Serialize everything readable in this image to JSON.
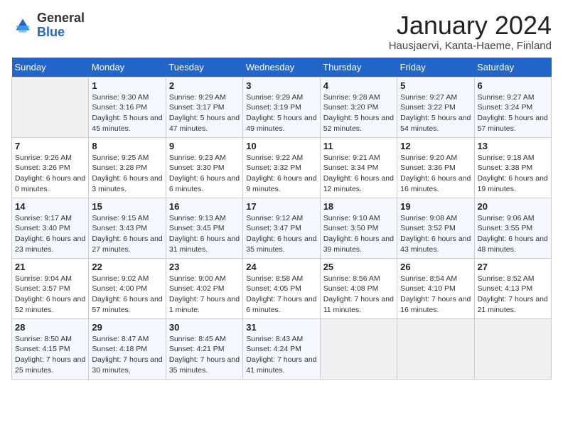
{
  "header": {
    "logo_general": "General",
    "logo_blue": "Blue",
    "month_title": "January 2024",
    "location": "Hausjaervi, Kanta-Haeme, Finland"
  },
  "weekdays": [
    "Sunday",
    "Monday",
    "Tuesday",
    "Wednesday",
    "Thursday",
    "Friday",
    "Saturday"
  ],
  "weeks": [
    [
      {
        "day": "",
        "empty": true
      },
      {
        "day": "1",
        "sunrise": "9:30 AM",
        "sunset": "3:16 PM",
        "daylight": "5 hours and 45 minutes."
      },
      {
        "day": "2",
        "sunrise": "9:29 AM",
        "sunset": "3:17 PM",
        "daylight": "5 hours and 47 minutes."
      },
      {
        "day": "3",
        "sunrise": "9:29 AM",
        "sunset": "3:19 PM",
        "daylight": "5 hours and 49 minutes."
      },
      {
        "day": "4",
        "sunrise": "9:28 AM",
        "sunset": "3:20 PM",
        "daylight": "5 hours and 52 minutes."
      },
      {
        "day": "5",
        "sunrise": "9:27 AM",
        "sunset": "3:22 PM",
        "daylight": "5 hours and 54 minutes."
      },
      {
        "day": "6",
        "sunrise": "9:27 AM",
        "sunset": "3:24 PM",
        "daylight": "5 hours and 57 minutes."
      }
    ],
    [
      {
        "day": "7",
        "sunrise": "9:26 AM",
        "sunset": "3:26 PM",
        "daylight": "6 hours and 0 minutes."
      },
      {
        "day": "8",
        "sunrise": "9:25 AM",
        "sunset": "3:28 PM",
        "daylight": "6 hours and 3 minutes."
      },
      {
        "day": "9",
        "sunrise": "9:23 AM",
        "sunset": "3:30 PM",
        "daylight": "6 hours and 6 minutes."
      },
      {
        "day": "10",
        "sunrise": "9:22 AM",
        "sunset": "3:32 PM",
        "daylight": "6 hours and 9 minutes."
      },
      {
        "day": "11",
        "sunrise": "9:21 AM",
        "sunset": "3:34 PM",
        "daylight": "6 hours and 12 minutes."
      },
      {
        "day": "12",
        "sunrise": "9:20 AM",
        "sunset": "3:36 PM",
        "daylight": "6 hours and 16 minutes."
      },
      {
        "day": "13",
        "sunrise": "9:18 AM",
        "sunset": "3:38 PM",
        "daylight": "6 hours and 19 minutes."
      }
    ],
    [
      {
        "day": "14",
        "sunrise": "9:17 AM",
        "sunset": "3:40 PM",
        "daylight": "6 hours and 23 minutes."
      },
      {
        "day": "15",
        "sunrise": "9:15 AM",
        "sunset": "3:43 PM",
        "daylight": "6 hours and 27 minutes."
      },
      {
        "day": "16",
        "sunrise": "9:13 AM",
        "sunset": "3:45 PM",
        "daylight": "6 hours and 31 minutes."
      },
      {
        "day": "17",
        "sunrise": "9:12 AM",
        "sunset": "3:47 PM",
        "daylight": "6 hours and 35 minutes."
      },
      {
        "day": "18",
        "sunrise": "9:10 AM",
        "sunset": "3:50 PM",
        "daylight": "6 hours and 39 minutes."
      },
      {
        "day": "19",
        "sunrise": "9:08 AM",
        "sunset": "3:52 PM",
        "daylight": "6 hours and 43 minutes."
      },
      {
        "day": "20",
        "sunrise": "9:06 AM",
        "sunset": "3:55 PM",
        "daylight": "6 hours and 48 minutes."
      }
    ],
    [
      {
        "day": "21",
        "sunrise": "9:04 AM",
        "sunset": "3:57 PM",
        "daylight": "6 hours and 52 minutes."
      },
      {
        "day": "22",
        "sunrise": "9:02 AM",
        "sunset": "4:00 PM",
        "daylight": "6 hours and 57 minutes."
      },
      {
        "day": "23",
        "sunrise": "9:00 AM",
        "sunset": "4:02 PM",
        "daylight": "7 hours and 1 minute."
      },
      {
        "day": "24",
        "sunrise": "8:58 AM",
        "sunset": "4:05 PM",
        "daylight": "7 hours and 6 minutes."
      },
      {
        "day": "25",
        "sunrise": "8:56 AM",
        "sunset": "4:08 PM",
        "daylight": "7 hours and 11 minutes."
      },
      {
        "day": "26",
        "sunrise": "8:54 AM",
        "sunset": "4:10 PM",
        "daylight": "7 hours and 16 minutes."
      },
      {
        "day": "27",
        "sunrise": "8:52 AM",
        "sunset": "4:13 PM",
        "daylight": "7 hours and 21 minutes."
      }
    ],
    [
      {
        "day": "28",
        "sunrise": "8:50 AM",
        "sunset": "4:15 PM",
        "daylight": "7 hours and 25 minutes."
      },
      {
        "day": "29",
        "sunrise": "8:47 AM",
        "sunset": "4:18 PM",
        "daylight": "7 hours and 30 minutes."
      },
      {
        "day": "30",
        "sunrise": "8:45 AM",
        "sunset": "4:21 PM",
        "daylight": "7 hours and 35 minutes."
      },
      {
        "day": "31",
        "sunrise": "8:43 AM",
        "sunset": "4:24 PM",
        "daylight": "7 hours and 41 minutes."
      },
      {
        "day": "",
        "empty": true
      },
      {
        "day": "",
        "empty": true
      },
      {
        "day": "",
        "empty": true
      }
    ]
  ],
  "labels": {
    "sunrise": "Sunrise:",
    "sunset": "Sunset:",
    "daylight": "Daylight:"
  }
}
